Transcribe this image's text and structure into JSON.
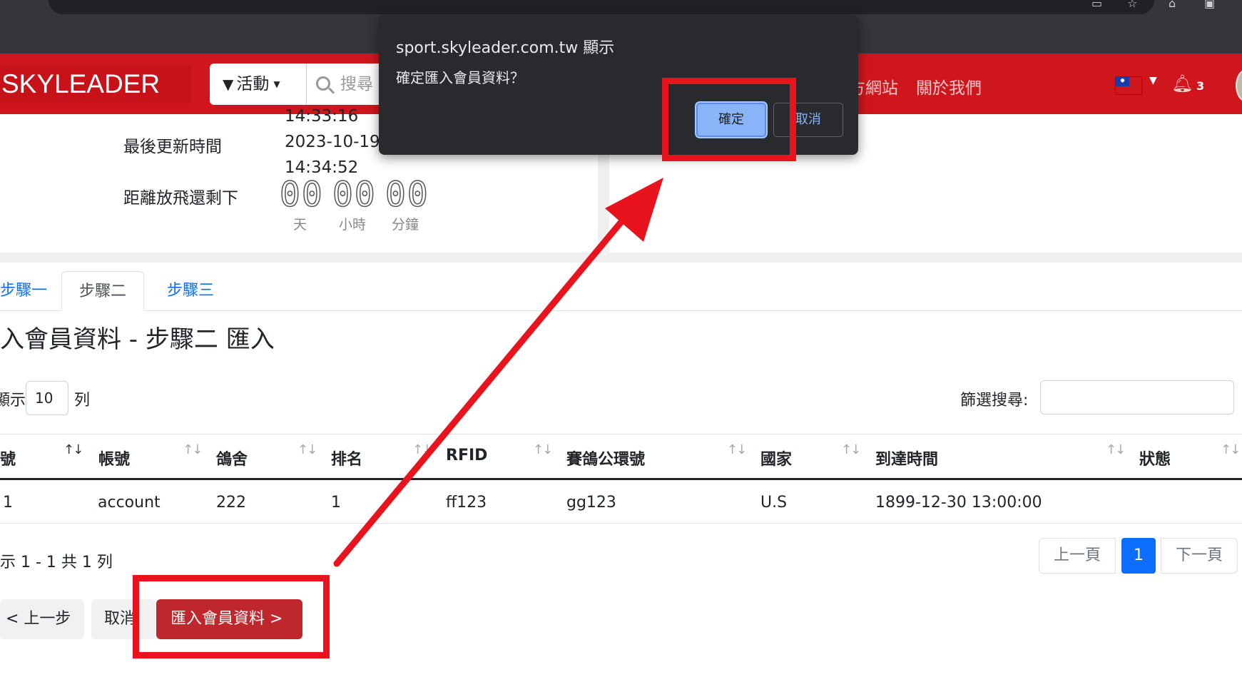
{
  "header": {
    "logo": "SKYLEADER",
    "filter_label": "活動",
    "search_placeholder": "搜尋",
    "nav": [
      "官方網站",
      "關於我們"
    ],
    "nav_visible_partial": "方網站",
    "notification_count": "3"
  },
  "info": {
    "time_line1": "14:33:16",
    "last_update_label": "最後更新時間",
    "last_update_date": "2023-10-19",
    "last_update_time": "14:34:52",
    "countdown_label": "距離放飛還剩下",
    "countdown": [
      {
        "digits": "00",
        "unit": "天"
      },
      {
        "digits": "00",
        "unit": "小時"
      },
      {
        "digits": "00",
        "unit": "分鐘"
      }
    ]
  },
  "tabs": [
    "步驟一",
    "步驟二",
    "步驟三"
  ],
  "page_title": "入會員資料 - 步驟二 匯入",
  "length": {
    "prefix": "顯示",
    "value": "10",
    "suffix": "列"
  },
  "filter": {
    "label": "篩選搜尋:",
    "value": ""
  },
  "table": {
    "columns": [
      "號",
      "帳號",
      "鴿舍",
      "排名",
      "RFID",
      "賽鴿公環號",
      "國家",
      "到達時間",
      "狀態"
    ],
    "rows": [
      [
        "1",
        "account",
        "222",
        "1",
        "ff123",
        "gg123",
        "U.S",
        "1899-12-30 13:00:00",
        ""
      ]
    ]
  },
  "table_info": "示 1 - 1 共 1 列",
  "pagination": {
    "prev": "上一頁",
    "current": "1",
    "next": "下一頁"
  },
  "buttons": {
    "back": "< 上一步",
    "cancel": "取消",
    "import": "匯入會員資料 >"
  },
  "dialog": {
    "title": "sport.skyleader.com.tw 顯示",
    "message": "確定匯入會員資料？",
    "ok": "確定",
    "cancel": "取消"
  },
  "annotation_color": "#e8131c"
}
